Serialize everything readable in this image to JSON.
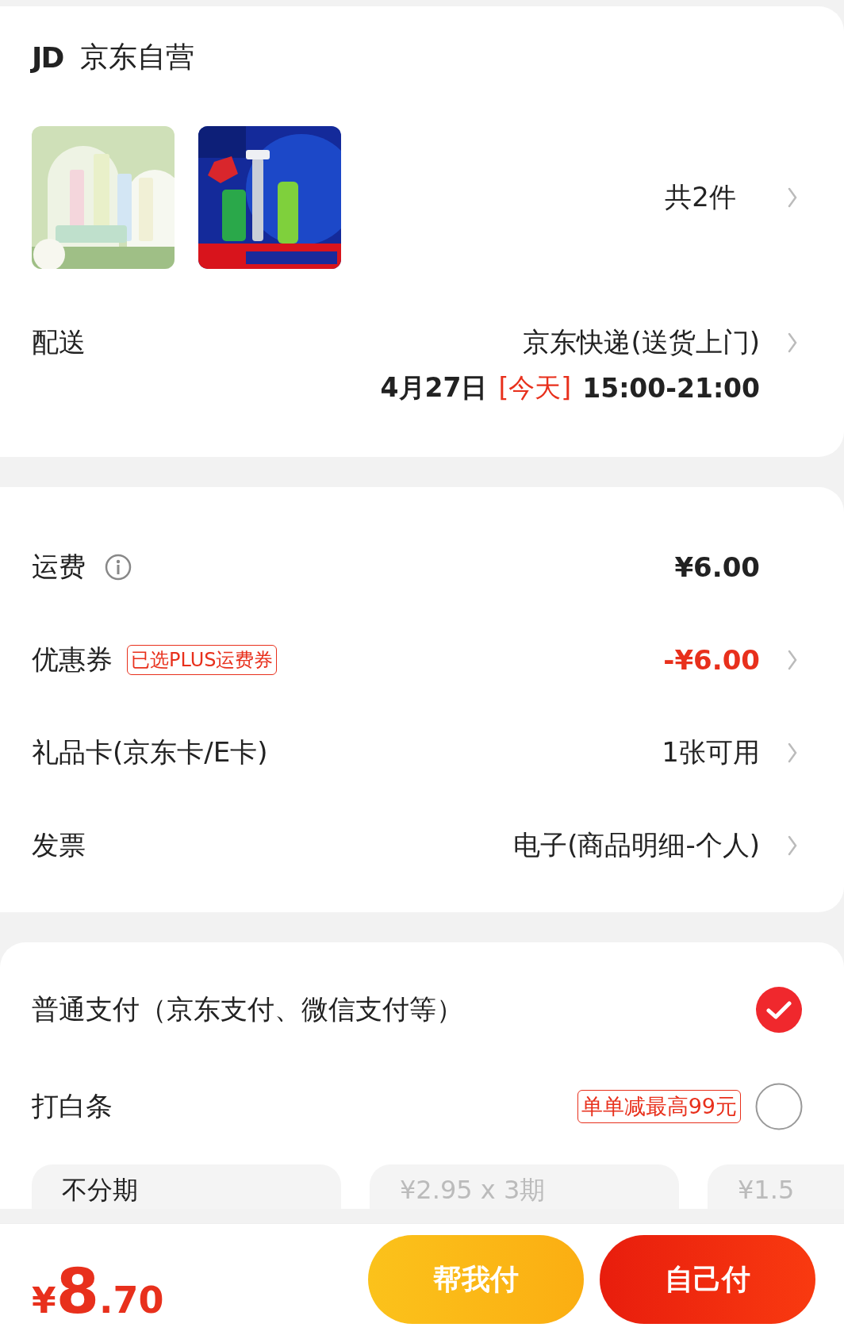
{
  "store": {
    "logo": "JD",
    "name": "京东自营"
  },
  "items": {
    "count": "共2件"
  },
  "delivery": {
    "label": "配送",
    "method": "京东快递(送货上门)",
    "date": "4月27日",
    "day_tag": "[今天]",
    "time": "15:00-21:00"
  },
  "fees": [
    {
      "kind": "info",
      "label": "运费",
      "value": "¥6.00",
      "highlight": false
    },
    {
      "kind": "link",
      "label": "优惠券",
      "tag": "已选PLUS运费券",
      "value": "-¥6.00",
      "highlight": true
    },
    {
      "kind": "link",
      "label": "礼品卡(京东卡/E卡)",
      "value": "1张可用",
      "highlight": false
    },
    {
      "kind": "link",
      "label": "发票",
      "value": "电子(商品明细-个人)",
      "highlight": false
    }
  ],
  "payments": [
    {
      "label": "普通支付（京东支付、微信支付等）",
      "selected": true
    },
    {
      "label": "打白条",
      "tag": "单单减最高99元",
      "selected": false
    }
  ],
  "installments": [
    {
      "label": "不分期",
      "disabled": false
    },
    {
      "label": "¥2.95 x 3期",
      "disabled": true
    },
    {
      "label": "¥1.5",
      "disabled": true
    }
  ],
  "total": {
    "currency": "¥",
    "integer": "8",
    "decimal": ".70"
  },
  "buttons": [
    {
      "label": "帮我付",
      "kind": "secondary"
    },
    {
      "label": "自己付",
      "kind": "primary"
    }
  ]
}
